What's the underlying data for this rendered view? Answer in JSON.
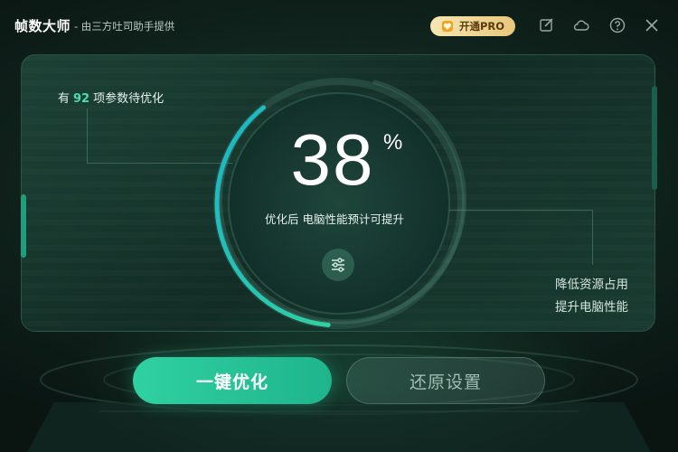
{
  "titlebar": {
    "app_name": "帧数大师",
    "subtitle": "- 由三方吐司助手提供",
    "pro_button": "开通PRO",
    "icons": [
      "edit-icon",
      "cloud-icon",
      "help-icon",
      "close-icon"
    ]
  },
  "summary": {
    "prefix": "有",
    "count": "92",
    "suffix": "项参数待优化"
  },
  "gauge": {
    "percent": "38",
    "percent_sign": "%",
    "caption": "优化后 电脑性能预计可提升",
    "progress": 0.38
  },
  "benefits": [
    "降低资源占用",
    "提升电脑性能"
  ],
  "actions": {
    "optimize": "一键优化",
    "restore": "还原设置"
  },
  "colors": {
    "accent": "#2fd1a1",
    "accent_cyan": "#1ab5c9",
    "pro_gold": "#e7c77a",
    "panel_bg": "#1b3a30"
  }
}
